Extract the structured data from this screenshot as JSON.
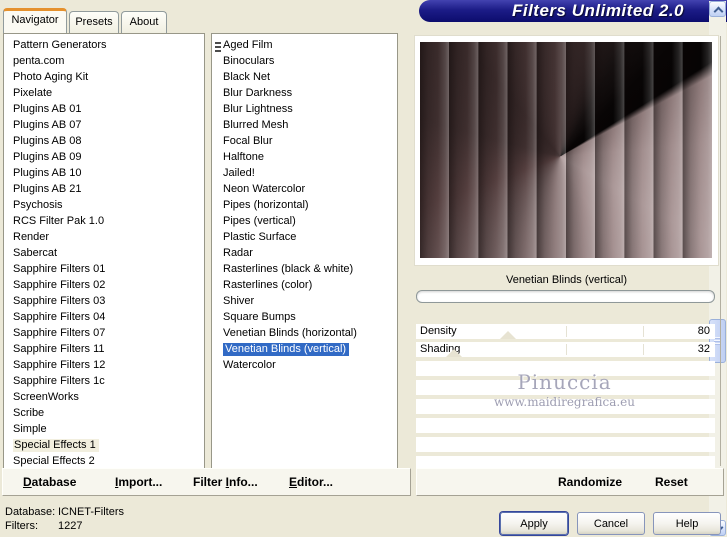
{
  "window": {
    "title": "Filters Unlimited 2.0"
  },
  "tabs": [
    {
      "label": "Navigator",
      "active": true
    },
    {
      "label": "Presets",
      "active": false
    },
    {
      "label": "About",
      "active": false
    }
  ],
  "left_list": {
    "items": [
      "Pattern Generators",
      "penta.com",
      "Photo Aging Kit",
      "Pixelate",
      "Plugins AB 01",
      "Plugins AB 07",
      "Plugins AB 08",
      "Plugins AB 09",
      "Plugins AB 10",
      "Plugins AB 21",
      "Psychosis",
      "RCS Filter Pak 1.0",
      "Render",
      "Sabercat",
      "Sapphire Filters 01",
      "Sapphire Filters 02",
      "Sapphire Filters 03",
      "Sapphire Filters 04",
      "Sapphire Filters 07",
      "Sapphire Filters 11",
      "Sapphire Filters 12",
      "Sapphire Filters 1c",
      "ScreenWorks",
      "Scribe",
      "Simple",
      "Special Effects 1",
      "Special Effects 2"
    ],
    "selected": "Special Effects 1"
  },
  "filter_list": {
    "items": [
      "Aged Film",
      "Binoculars",
      "Black Net",
      "Blur Darkness",
      "Blur Lightness",
      "Blurred Mesh",
      "Focal Blur",
      "Halftone",
      "Jailed!",
      "Neon Watercolor",
      "Pipes (horizontal)",
      "Pipes (vertical)",
      "Plastic Surface",
      "Radar",
      "Rasterlines (black & white)",
      "Rasterlines (color)",
      "Shiver",
      "Square Bumps",
      "Venetian Blinds (horizontal)",
      "Venetian Blinds (vertical)",
      "Watercolor"
    ],
    "selected": "Venetian Blinds (vertical)"
  },
  "preview": {
    "caption": "Venetian Blinds (vertical)"
  },
  "params": [
    {
      "name": "Density",
      "value": 80
    },
    {
      "name": "Shading",
      "value": 32
    }
  ],
  "watermark": {
    "name": "Pinuccia",
    "url": "www.maidiregrafica.eu"
  },
  "menu": {
    "database": {
      "label": "Database",
      "hotkey": "D"
    },
    "import": {
      "label": "Import...",
      "hotkey": "I"
    },
    "filter_info": {
      "label": "Filter Info...",
      "hotkey": "I"
    },
    "editor": {
      "label": "Editor...",
      "hotkey": "E"
    },
    "randomize": {
      "label": "Randomize",
      "hotkey": null
    },
    "reset": {
      "label": "Reset",
      "hotkey": null
    }
  },
  "status": {
    "rows": [
      {
        "label": "Database:",
        "value": "ICNET-Filters"
      },
      {
        "label": "Filters:",
        "value": "1227"
      }
    ]
  },
  "buttons": {
    "apply": "Apply",
    "cancel": "Cancel",
    "help": "Help"
  },
  "colors": {
    "selection_blue": "#316ac5",
    "title_navy": "#14147e",
    "tab_accent_orange": "#e5912d",
    "window_beige": "#ece9d8"
  }
}
